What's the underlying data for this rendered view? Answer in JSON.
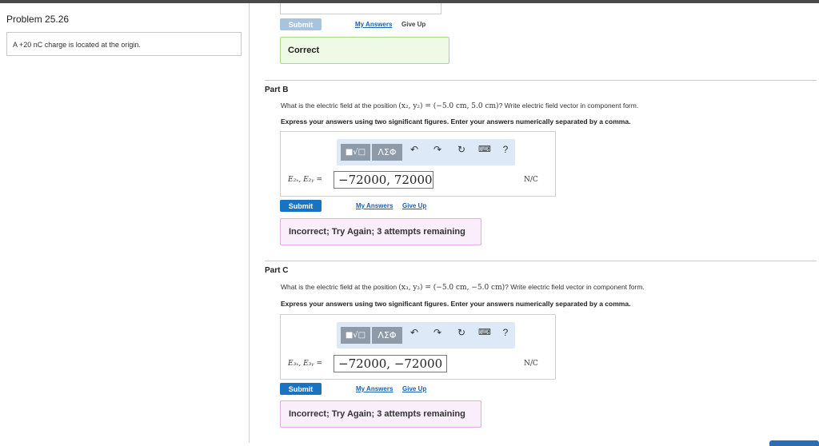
{
  "left": {
    "title": "Problem 25.26",
    "statement": "A +20 nC charge is located at the origin."
  },
  "partA": {
    "submit": "Submit",
    "my_answers": "My Answers",
    "give_up": "Give Up",
    "feedback": "Correct"
  },
  "partB": {
    "label": "Part B",
    "question_pre": "What is the electric field at the position ",
    "question_math": "(x₂, y₂) = (−5.0 cm, 5.0 cm)",
    "question_post": "? Write electric field vector in component form.",
    "instruction": "Express your answers using two significant figures. Enter your answers numerically separated by a comma.",
    "toolbar_symbols": "ΛΣΦ",
    "answer_label": "E₂ₓ, E₂ᵧ =",
    "answer_value": "−72000, 72000",
    "unit": "N/C",
    "submit": "Submit",
    "my_answers": "My Answers",
    "give_up": "Give Up",
    "feedback": "Incorrect; Try Again; 3 attempts remaining"
  },
  "partC": {
    "label": "Part C",
    "question_pre": "What is the electric field at the position ",
    "question_math": "(x₃, y₃) = (−5.0 cm, −5.0 cm)",
    "question_post": "? Write electric field vector in component form.",
    "instruction": "Express your answers using two significant figures. Enter your answers numerically separated by a comma.",
    "toolbar_symbols": "ΛΣΦ",
    "answer_label": "E₃ₓ, E₃ᵧ =",
    "answer_value": "−72000, −72000",
    "unit": "N/C",
    "submit": "Submit",
    "my_answers": "My Answers",
    "give_up": "Give Up",
    "feedback": "Incorrect; Try Again; 3 attempts remaining"
  }
}
